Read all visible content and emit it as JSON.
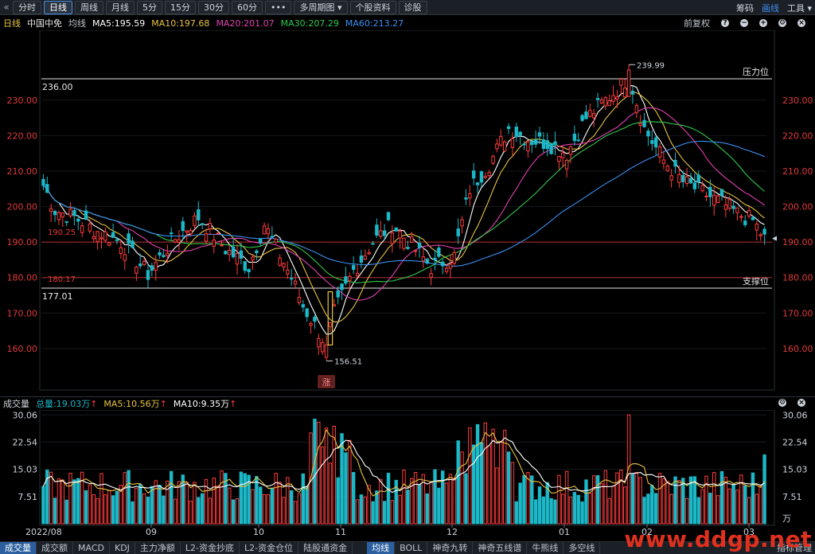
{
  "toolbar": {
    "tabs": [
      {
        "label": "分时",
        "active": false
      },
      {
        "label": "日线",
        "active": true
      },
      {
        "label": "周线",
        "active": false
      },
      {
        "label": "月线",
        "active": false
      },
      {
        "label": "5分",
        "active": false
      },
      {
        "label": "15分",
        "active": false
      },
      {
        "label": "30分",
        "active": false
      },
      {
        "label": "60分",
        "active": false
      },
      {
        "label": "•••",
        "active": false
      },
      {
        "label": "多周期图 ▾",
        "active": false
      },
      {
        "label": "个股资料",
        "active": false
      },
      {
        "label": "诊股",
        "active": false
      }
    ],
    "right": {
      "chouma": "筹码",
      "huaxian": "画线",
      "gongju": "工具 ▾"
    }
  },
  "info": {
    "period": "日线",
    "stock": "中国中免",
    "junxian": "均线",
    "ma5": "MA5:195.59",
    "ma10": "MA10:197.68",
    "ma20": "MA20:201.07",
    "ma30": "MA30:207.29",
    "ma60": "MA60:213.27",
    "fuquan": "前复权"
  },
  "volume_info": {
    "title": "成交量",
    "total": "总量:19.03万",
    "ma5": "MA5:10.56万",
    "ma10": "MA10:9.35万"
  },
  "bottom_tabs": {
    "left": [
      "成交量",
      "成交额",
      "MACD",
      "KDJ",
      "主力净额",
      "L2-资金抄底",
      "L2-资金仓位",
      "陆股通资金"
    ],
    "mid": [
      "均线",
      "BOLL",
      "神奇九转",
      "神奇五线谱",
      "牛熊线",
      "多空线"
    ],
    "indicator": "指标管理"
  },
  "watermark": "www.ddgp.net",
  "colors": {
    "up": "#ff3b3b",
    "down": "#1bb8c8",
    "ma5": "#ffffff",
    "ma10": "#e8c341",
    "ma20": "#e040b0",
    "ma30": "#2ec94a",
    "ma60": "#3a8ef0"
  },
  "chart_data": [
    {
      "type": "candlestick",
      "title": "中国中免 日线",
      "y_ticks": [
        "230.00",
        "220.00",
        "210.00",
        "200.00",
        "190.00",
        "180.00",
        "170.00",
        "160.00"
      ],
      "ylim": [
        151,
        247
      ],
      "x_ticks": [
        "2022/08",
        "09",
        "10",
        "11",
        "12",
        "01",
        "02",
        "03"
      ],
      "horizontal_lines": [
        {
          "value": 236.0,
          "label": "236.00",
          "tag": "压力位"
        },
        {
          "value": 177.01,
          "label": "177.01",
          "tag": "支撑位"
        },
        {
          "value": 190.0,
          "label": ""
        },
        {
          "value": 180.0,
          "label": ""
        }
      ],
      "annotations": [
        "239.99",
        "156.51",
        "190.25",
        "180.17"
      ],
      "highlight_label": "涨",
      "key_points": [
        {
          "date": "2022/08 start",
          "open": 199,
          "close": 207
        },
        {
          "date": "2022/10 end",
          "low": 156.51
        },
        {
          "date": "2023/02 start",
          "high": 239.99
        },
        {
          "date": "2023/03 latest",
          "close": 190.7
        }
      ],
      "ma_last": {
        "MA5": 195.59,
        "MA10": 197.68,
        "MA20": 201.07,
        "MA30": 207.29,
        "MA60": 213.27
      }
    },
    {
      "type": "bar",
      "title": "成交量",
      "unit": "万",
      "y_ticks": [
        "30.06",
        "22.54",
        "15.03",
        "7.51"
      ],
      "ylim": [
        0,
        31
      ],
      "total_last": 19.03,
      "ma5_last": 10.56,
      "ma10_last": 9.35
    }
  ]
}
